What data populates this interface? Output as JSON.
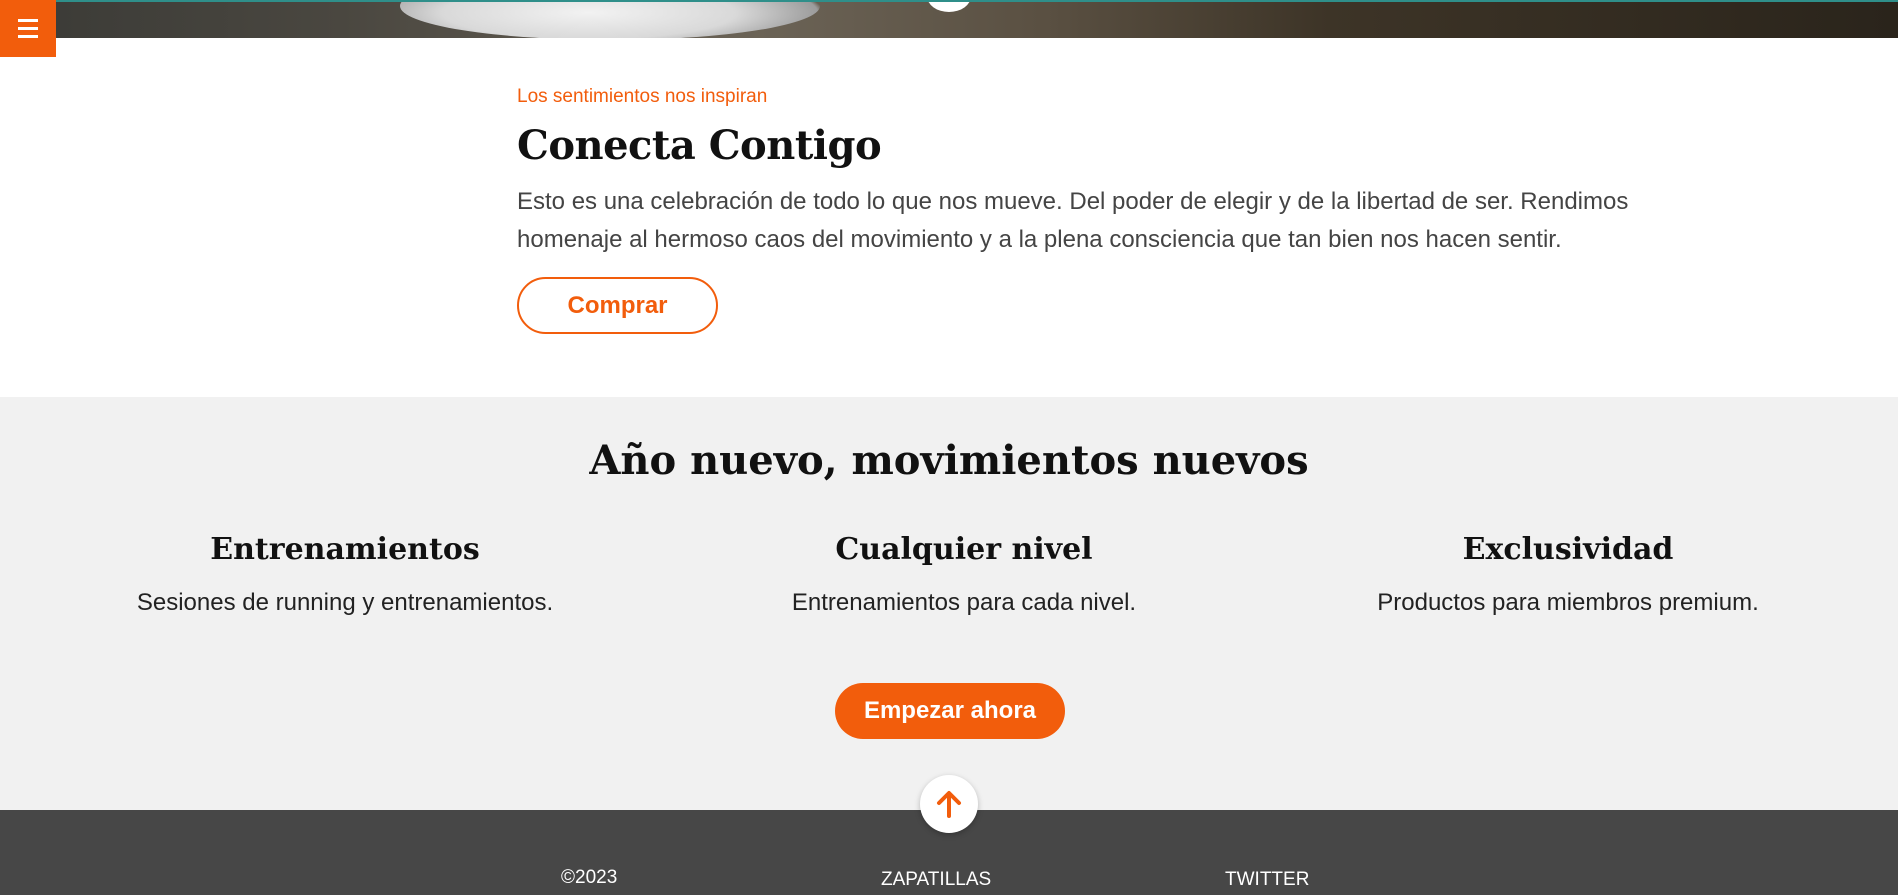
{
  "colors": {
    "accent": "#f25d0c",
    "section_bg": "#f1f1f1",
    "footer_bg": "#474747"
  },
  "menu": {
    "icon": "hamburger-menu-icon"
  },
  "intro": {
    "eyebrow": "Los sentimientos nos inspiran",
    "title": "Conecta Contigo",
    "body": "Esto es una celebración de todo lo que nos mueve. Del poder de elegir y de la libertad de ser. Rendimos homenaje al hermoso caos del movimiento y a la plena consciencia que tan bien nos hacen sentir.",
    "button_label": "Comprar"
  },
  "features": {
    "title": "Año nuevo, movimientos nuevos",
    "items": [
      {
        "title": "Entrenamientos",
        "text": "Sesiones de running y entrenamientos."
      },
      {
        "title": "Cualquier nivel",
        "text": "Entrenamientos para cada nivel."
      },
      {
        "title": "Exclusividad",
        "text": "Productos para miembros premium."
      }
    ],
    "button_label": "Empezar ahora"
  },
  "scroll_top": {
    "icon": "arrow-up-icon"
  },
  "footer": {
    "copyright": "©2023",
    "link_1": "ZAPATILLAS",
    "link_2": "TWITTER"
  }
}
